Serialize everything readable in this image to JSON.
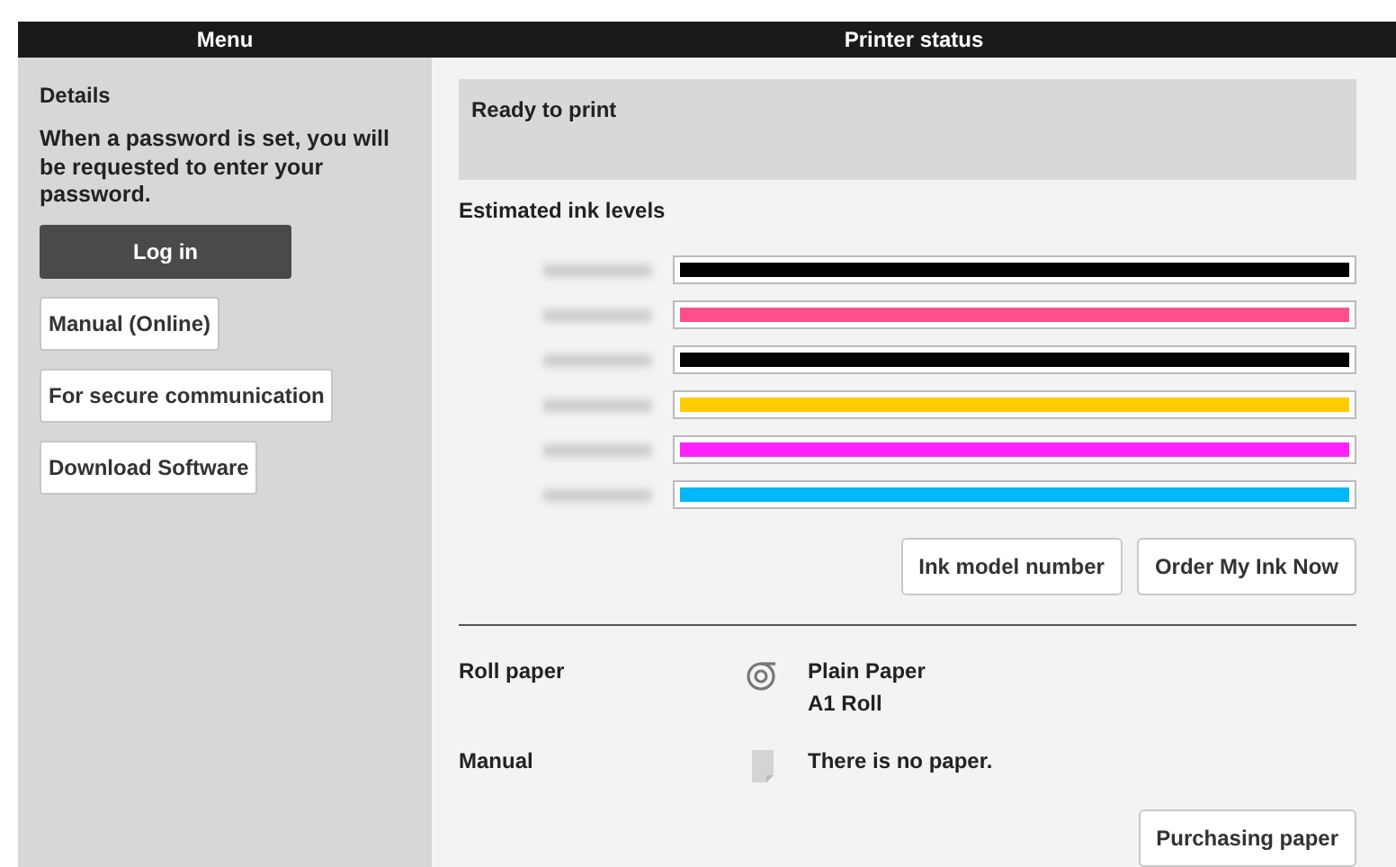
{
  "header": {
    "menu_title": "Menu",
    "status_title": "Printer status"
  },
  "sidebar": {
    "heading": "Details",
    "note": "When a password is set, you will be requested to enter your password.",
    "buttons": [
      {
        "label": "Log in",
        "kind": "primary"
      },
      {
        "label": "Manual (Online)",
        "kind": "plain"
      },
      {
        "label": "For secure communication",
        "kind": "plain"
      },
      {
        "label": "Download Software",
        "kind": "plain"
      }
    ]
  },
  "status": {
    "message": "Ready to print",
    "ink_heading": "Estimated ink levels",
    "inks": [
      {
        "color": "#000000",
        "level": 1
      },
      {
        "color": "#ff4f8b",
        "level": 1
      },
      {
        "color": "#000000",
        "level": 1
      },
      {
        "color": "#ffcc00",
        "level": 1
      },
      {
        "color": "#ff22ff",
        "level": 1
      },
      {
        "color": "#00b8f5",
        "level": 1
      }
    ],
    "ink_buttons": [
      "Ink model number",
      "Order My Ink Now"
    ],
    "paper": [
      {
        "label": "Roll paper",
        "kind": "roll",
        "lines": [
          "Plain Paper",
          "A1 Roll"
        ]
      },
      {
        "label": "Manual",
        "kind": "sheet",
        "lines": [
          "There is no paper."
        ]
      }
    ],
    "paper_button": "Purchasing paper"
  }
}
